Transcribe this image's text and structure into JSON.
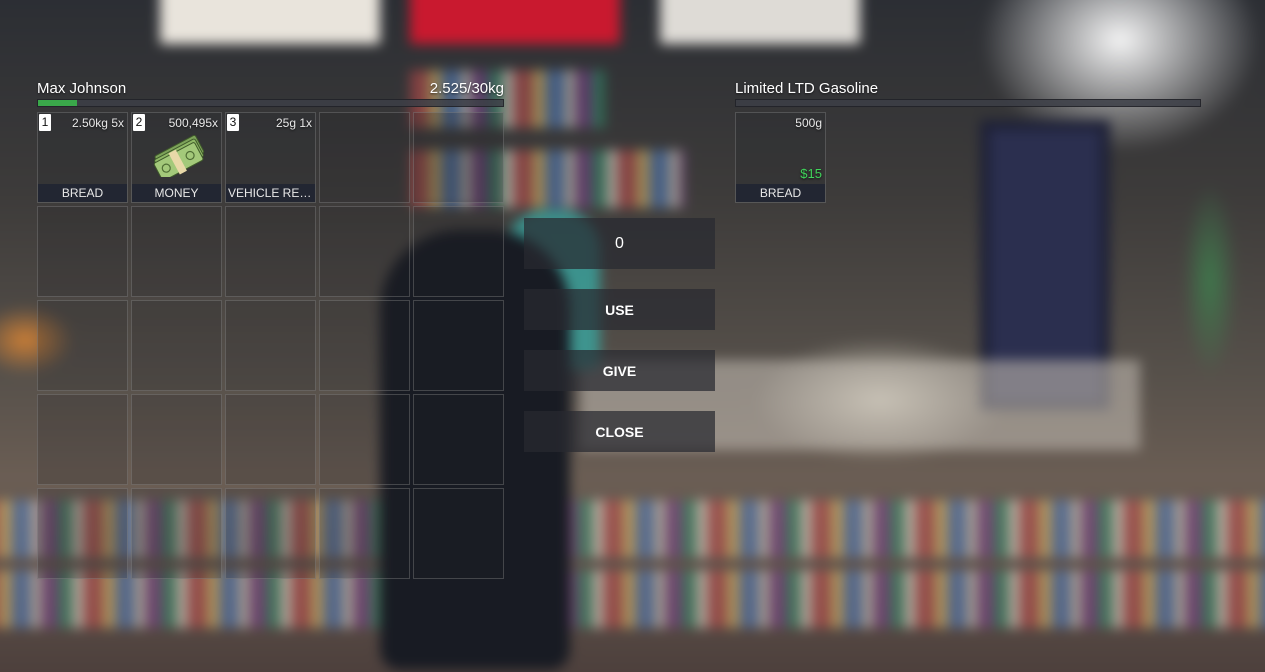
{
  "player": {
    "name": "Max Johnson",
    "weight_text": "2.525/30kg",
    "weight_fraction": 0.084,
    "slots": [
      {
        "num": "1",
        "info": "2.50kg 5x",
        "label": "BREAD",
        "icon": "bread-icon"
      },
      {
        "num": "2",
        "info": "500,495x",
        "label": "MONEY",
        "icon": "money-icon"
      },
      {
        "num": "3",
        "info": "25g 1x",
        "label": "VEHICLE REN...",
        "icon": "document-icon"
      }
    ]
  },
  "shop": {
    "name": "Limited LTD Gasoline",
    "weight_fraction": 0,
    "slots": [
      {
        "info": "500g",
        "price": "$15",
        "label": "BREAD",
        "icon": "bread-icon"
      }
    ]
  },
  "controls": {
    "amount_value": "0",
    "use_label": "USE",
    "give_label": "GIVE",
    "close_label": "CLOSE"
  },
  "colors": {
    "weight_bar": "#3aa84a",
    "price": "#3fd45a",
    "button_bg": "#28292f"
  }
}
